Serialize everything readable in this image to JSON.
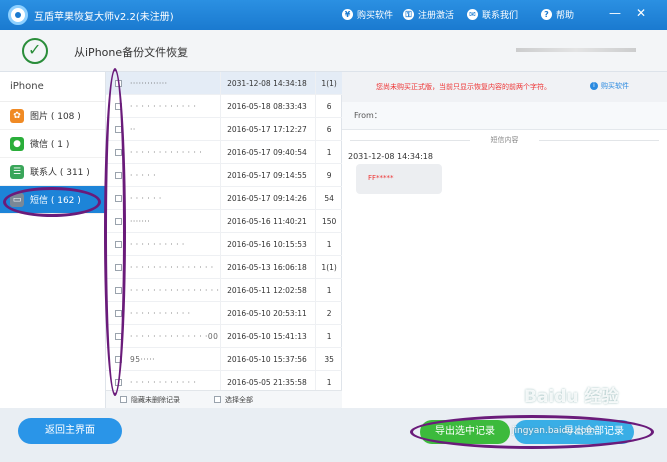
{
  "window": {
    "title": "互盾苹果恢复大师v2.2(未注册)",
    "buttons": [
      {
        "label": "购买软件",
        "icon": "cart-icon"
      },
      {
        "label": "注册激活",
        "icon": "key-icon"
      },
      {
        "label": "联系我们",
        "icon": "contact-icon"
      },
      {
        "label": "帮助",
        "icon": "help-icon"
      }
    ],
    "controls": [
      "—",
      "✕"
    ]
  },
  "header": {
    "title": "从iPhone备份文件恢复"
  },
  "sidebar": {
    "heading": "iPhone",
    "items": [
      {
        "label": "图片 ( 108 )",
        "icon": "photos-icon",
        "color": "#f08a24"
      },
      {
        "label": "微信 ( 1 )",
        "icon": "wechat-icon",
        "color": "#2aae3a"
      },
      {
        "label": "联系人 ( 311 )",
        "icon": "contacts-icon",
        "color": "#3aa65a"
      },
      {
        "label": "短信 ( 162 )",
        "icon": "sms-icon",
        "color": "#7a8896",
        "active": true
      }
    ]
  },
  "messages": {
    "rows": [
      {
        "name": "·············",
        "date": "2031-12-08 14:34:18",
        "count": "1(1)"
      },
      {
        "name": "· · · · · · · · · · · ·",
        "date": "2016-05-18 08:33:43",
        "count": "6"
      },
      {
        "name": "··",
        "date": "2016-05-17 17:12:27",
        "count": "6"
      },
      {
        "name": "· · · · · · · · · · · · ·",
        "date": "2016-05-17 09:40:54",
        "count": "1"
      },
      {
        "name": "· · · · ·",
        "date": "2016-05-17 09:14:55",
        "count": "9"
      },
      {
        "name": "· · · · · ·",
        "date": "2016-05-17 09:14:26",
        "count": "54"
      },
      {
        "name": "·······",
        "date": "2016-05-16 11:40:21",
        "count": "150"
      },
      {
        "name": "· · · · · · · · · ·",
        "date": "2016-05-16 10:15:53",
        "count": "1"
      },
      {
        "name": "· · · · · · · · · · · · · · ·",
        "date": "2016-05-13 16:06:18",
        "count": "1(1)"
      },
      {
        "name": "· · · · · · · · · · · · · · · ·",
        "date": "2016-05-11 12:02:58",
        "count": "1"
      },
      {
        "name": "· · · · · · · · · · ·",
        "date": "2016-05-10 20:53:11",
        "count": "2"
      },
      {
        "name": "· · · · · · · · · · · · · ·00",
        "date": "2016-05-10 15:41:13",
        "count": "1"
      },
      {
        "name": "95·····",
        "date": "2016-05-10 15:37:56",
        "count": "35"
      },
      {
        "name": "· · · · · · · · · · · ·",
        "date": "2016-05-05 21:35:58",
        "count": "1"
      }
    ],
    "footer": {
      "hide_undeleted": "隐藏未删除记录",
      "select_all": "选择全部"
    }
  },
  "detail": {
    "notice": "您尚未购买正式版，当前只显示恢复内容的前两个字符。",
    "buy_link": "购买软件",
    "from_label": "From：",
    "section_title": "短信内容",
    "message_date": "2031-12-08 14:34:18",
    "message_text": "FF*****"
  },
  "bottom": {
    "back_label": "返回主界面",
    "export_selected": "导出选中记录",
    "export_all": "导出全部记录"
  },
  "watermark": {
    "main": "Baidu 经验",
    "url": "jingyan.baidu.com"
  }
}
